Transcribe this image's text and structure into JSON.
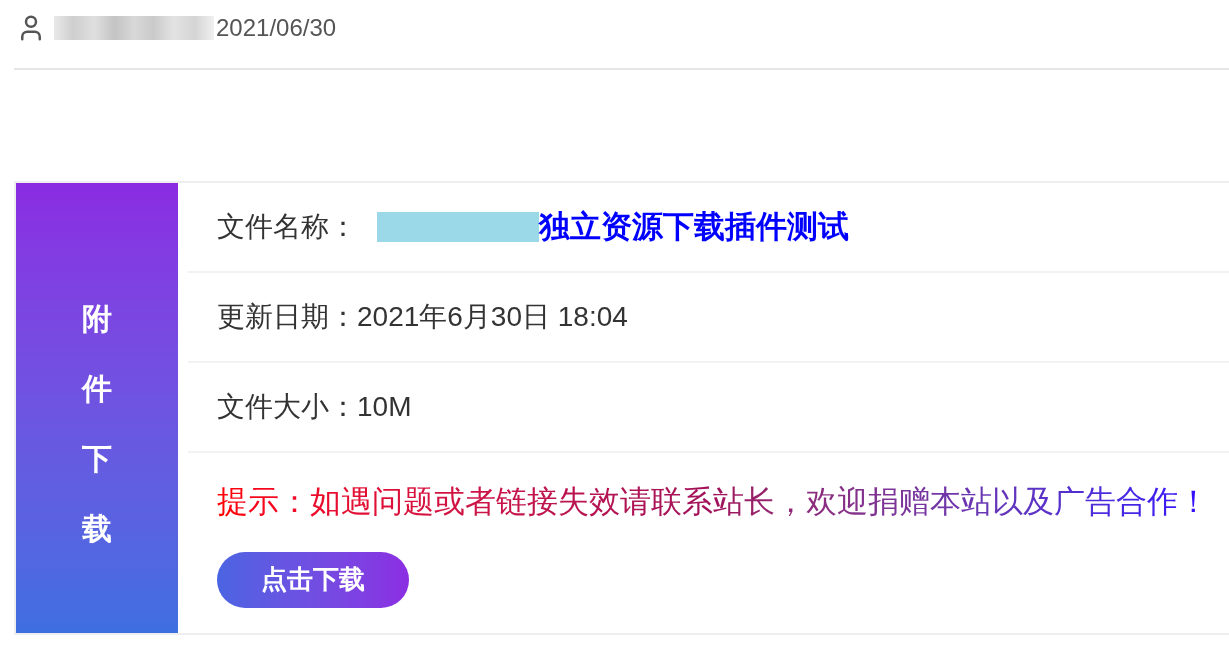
{
  "author": {
    "date": "2021/06/30"
  },
  "download_box": {
    "side_label": "附件下载",
    "fields": [
      {
        "kind": "title",
        "label": "文件名称：",
        "value": "独立资源下载插件测试"
      },
      {
        "kind": "plain",
        "label": "更新日期：",
        "value": "2021年6月30日 18:04"
      },
      {
        "kind": "plain",
        "label": "文件大小：",
        "value": "10M"
      }
    ],
    "notice": "提示：如遇问题或者链接失效请联系站长，欢迎捐赠本站以及广告合作！",
    "button": "点击下载"
  }
}
